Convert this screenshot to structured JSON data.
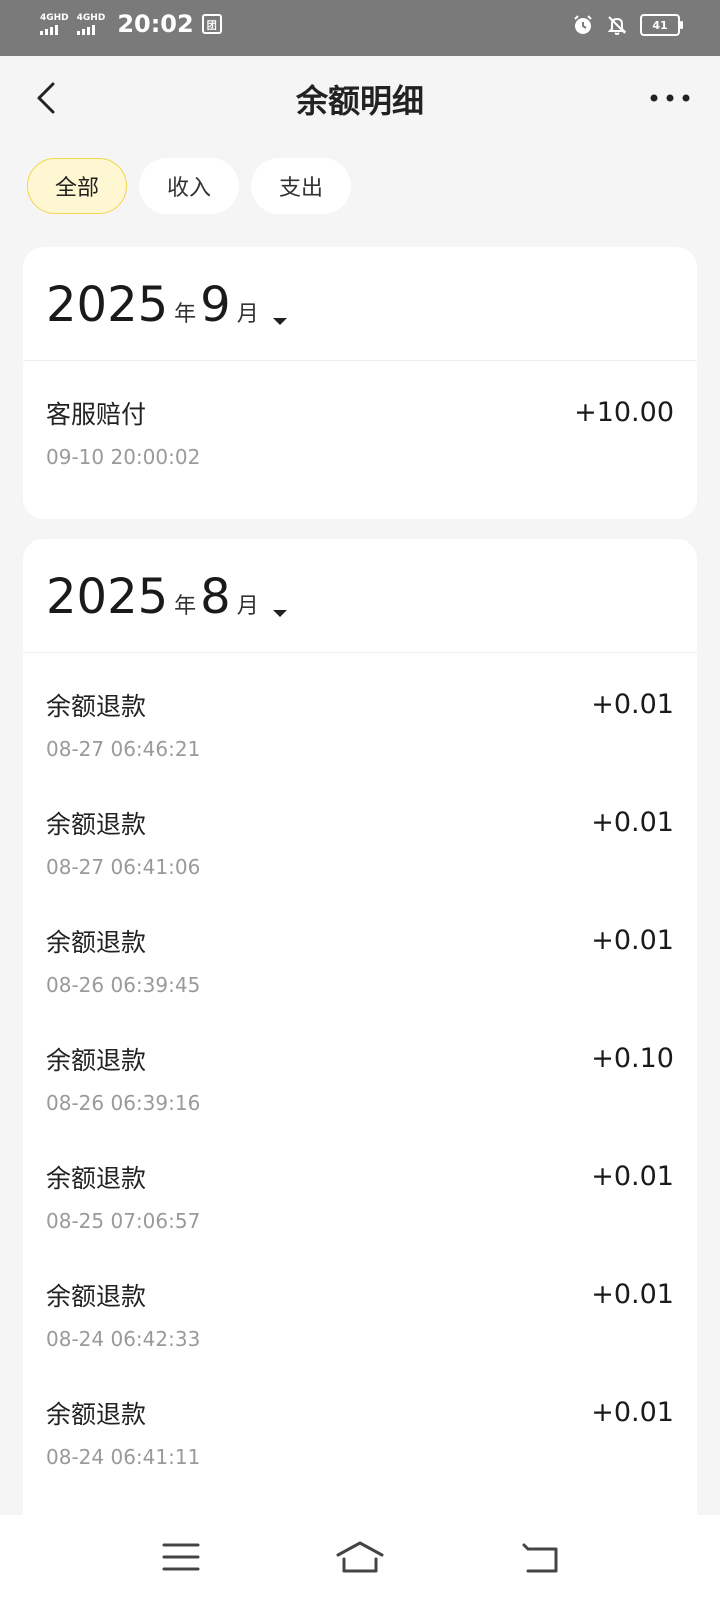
{
  "status": {
    "network1": "4GHD",
    "network2": "4GHD",
    "time": "20:02",
    "badge": "团",
    "battery": "41"
  },
  "header": {
    "title": "余额明细"
  },
  "tabs": [
    {
      "label": "全部",
      "active": true
    },
    {
      "label": "收入",
      "active": false
    },
    {
      "label": "支出",
      "active": false
    }
  ],
  "months": [
    {
      "year": "2025",
      "year_unit": "年",
      "month": "9",
      "month_unit": "月",
      "transactions": [
        {
          "title": "客服赔付",
          "time": "09-10 20:00:02",
          "amount": "+10.00"
        }
      ]
    },
    {
      "year": "2025",
      "year_unit": "年",
      "month": "8",
      "month_unit": "月",
      "transactions": [
        {
          "title": "余额退款",
          "time": "08-27 06:46:21",
          "amount": "+0.01"
        },
        {
          "title": "余额退款",
          "time": "08-27 06:41:06",
          "amount": "+0.01"
        },
        {
          "title": "余额退款",
          "time": "08-26 06:39:45",
          "amount": "+0.01"
        },
        {
          "title": "余额退款",
          "time": "08-26 06:39:16",
          "amount": "+0.10"
        },
        {
          "title": "余额退款",
          "time": "08-25 07:06:57",
          "amount": "+0.01"
        },
        {
          "title": "余额退款",
          "time": "08-24 06:42:33",
          "amount": "+0.01"
        },
        {
          "title": "余额退款",
          "time": "08-24 06:41:11",
          "amount": "+0.01"
        }
      ]
    }
  ],
  "icons": {
    "back": "chevron-left-icon",
    "more": "more-horizontal-icon",
    "alarm": "alarm-icon",
    "mute": "notifications-off-icon",
    "nav_menu": "menu-icon",
    "nav_home": "home-icon",
    "nav_back": "back-arrow-icon"
  }
}
